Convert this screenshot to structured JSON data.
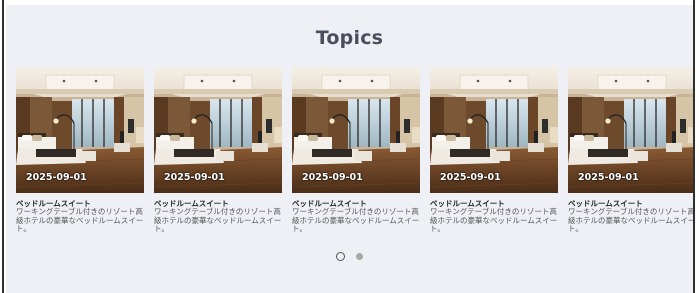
{
  "section": {
    "title": "Topics"
  },
  "cards": [
    {
      "date": "2025-09-01",
      "name": "ベッドルームスイート",
      "description": "ワーキングテーブル付きのリゾート高級ホテルの豪華なベッドルームスイート。"
    },
    {
      "date": "2025-09-01",
      "name": "ベッドルームスイート",
      "description": "ワーキングテーブル付きのリゾート高級ホテルの豪華なベッドルームスイート。"
    },
    {
      "date": "2025-09-01",
      "name": "ベッドルームスイート",
      "description": "ワーキングテーブル付きのリゾート高級ホテルの豪華なベッドルームスイート。"
    },
    {
      "date": "2025-09-01",
      "name": "ベッドルームスイート",
      "description": "ワーキングテーブル付きのリゾート高級ホテルの豪華なベッドルームスイート。"
    },
    {
      "date": "2025-09-01",
      "name": "ベッドルームスイート",
      "description": "ワーキングテーブル付きのリゾート高級ホテルの豪華なベッドルームスイート。"
    }
  ],
  "pagination": {
    "pages": 2,
    "active_page": 1
  },
  "colors": {
    "section_background": "#eef0f5",
    "title": "#4a4f5e",
    "dot_inactive": "#a8a8a8"
  },
  "icons": {
    "card_image": "hotel-bedroom-photo"
  }
}
